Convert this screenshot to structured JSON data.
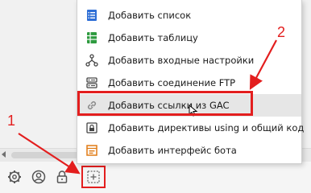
{
  "menu": {
    "items": [
      {
        "label": "Добавить список",
        "icon": "list-icon",
        "color": "#2f6fd6"
      },
      {
        "label": "Добавить таблицу",
        "icon": "table-icon",
        "color": "#2e9b3f"
      },
      {
        "label": "Добавить входные настройки",
        "icon": "input-settings-icon",
        "color": "#444444"
      },
      {
        "label": "Добавить соединение FTP",
        "icon": "ftp-server-icon",
        "color": "#444444"
      },
      {
        "label": "Добавить ссылки из GAC",
        "icon": "link-icon",
        "color": "#9a9a9a"
      },
      {
        "label": "Добавить директивы using и общий код",
        "icon": "code-lock-icon",
        "color": "#444444"
      },
      {
        "label": "Добавить интерфейс бота",
        "icon": "bot-interface-icon",
        "color": "#e07a14"
      }
    ],
    "hovered_index": 4
  },
  "footer": {
    "buttons": [
      {
        "name": "settings-icon"
      },
      {
        "name": "user-icon"
      },
      {
        "name": "lock-icon"
      },
      {
        "name": "add-icon"
      }
    ]
  },
  "annotations": {
    "label_1": "1",
    "label_2": "2",
    "color": "#e31e1e"
  }
}
